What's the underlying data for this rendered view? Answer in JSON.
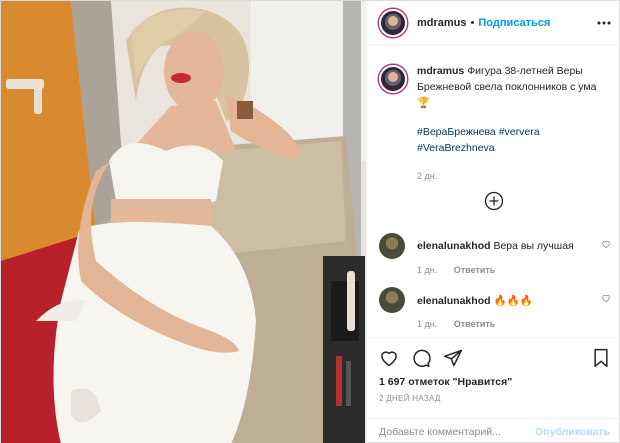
{
  "header": {
    "username": "mdramus",
    "separator": "•",
    "follow_label": "Подписаться"
  },
  "caption": {
    "username": "mdramus",
    "text": "Фигура 38-летней Веры Брежневой свела поклонников с ума 🏆",
    "hashtags": [
      "#ВераБрежнева",
      "#ververa",
      "#VeraBrezhneva"
    ],
    "time": "2 дн."
  },
  "comments": [
    {
      "username": "elenalunakhod",
      "text": "Вера вы лучшая",
      "time": "1 дн.",
      "reply_label": "Ответить"
    },
    {
      "username": "elenalunakhod",
      "text": "🔥🔥🔥",
      "time": "1 дн.",
      "reply_label": "Ответить"
    }
  ],
  "likes": {
    "text": "1 697 отметок \"Нравится\""
  },
  "date": "2 ДНЕЙ НАЗАД",
  "add_comment": {
    "placeholder": "Добавьте комментарий...",
    "publish_label": "Опубликовать"
  },
  "icons": {
    "more": "more-horizontal-icon",
    "load_more": "plus-circle-icon",
    "like": "heart-icon",
    "comment": "comment-icon",
    "share": "share-icon",
    "save": "bookmark-icon"
  }
}
